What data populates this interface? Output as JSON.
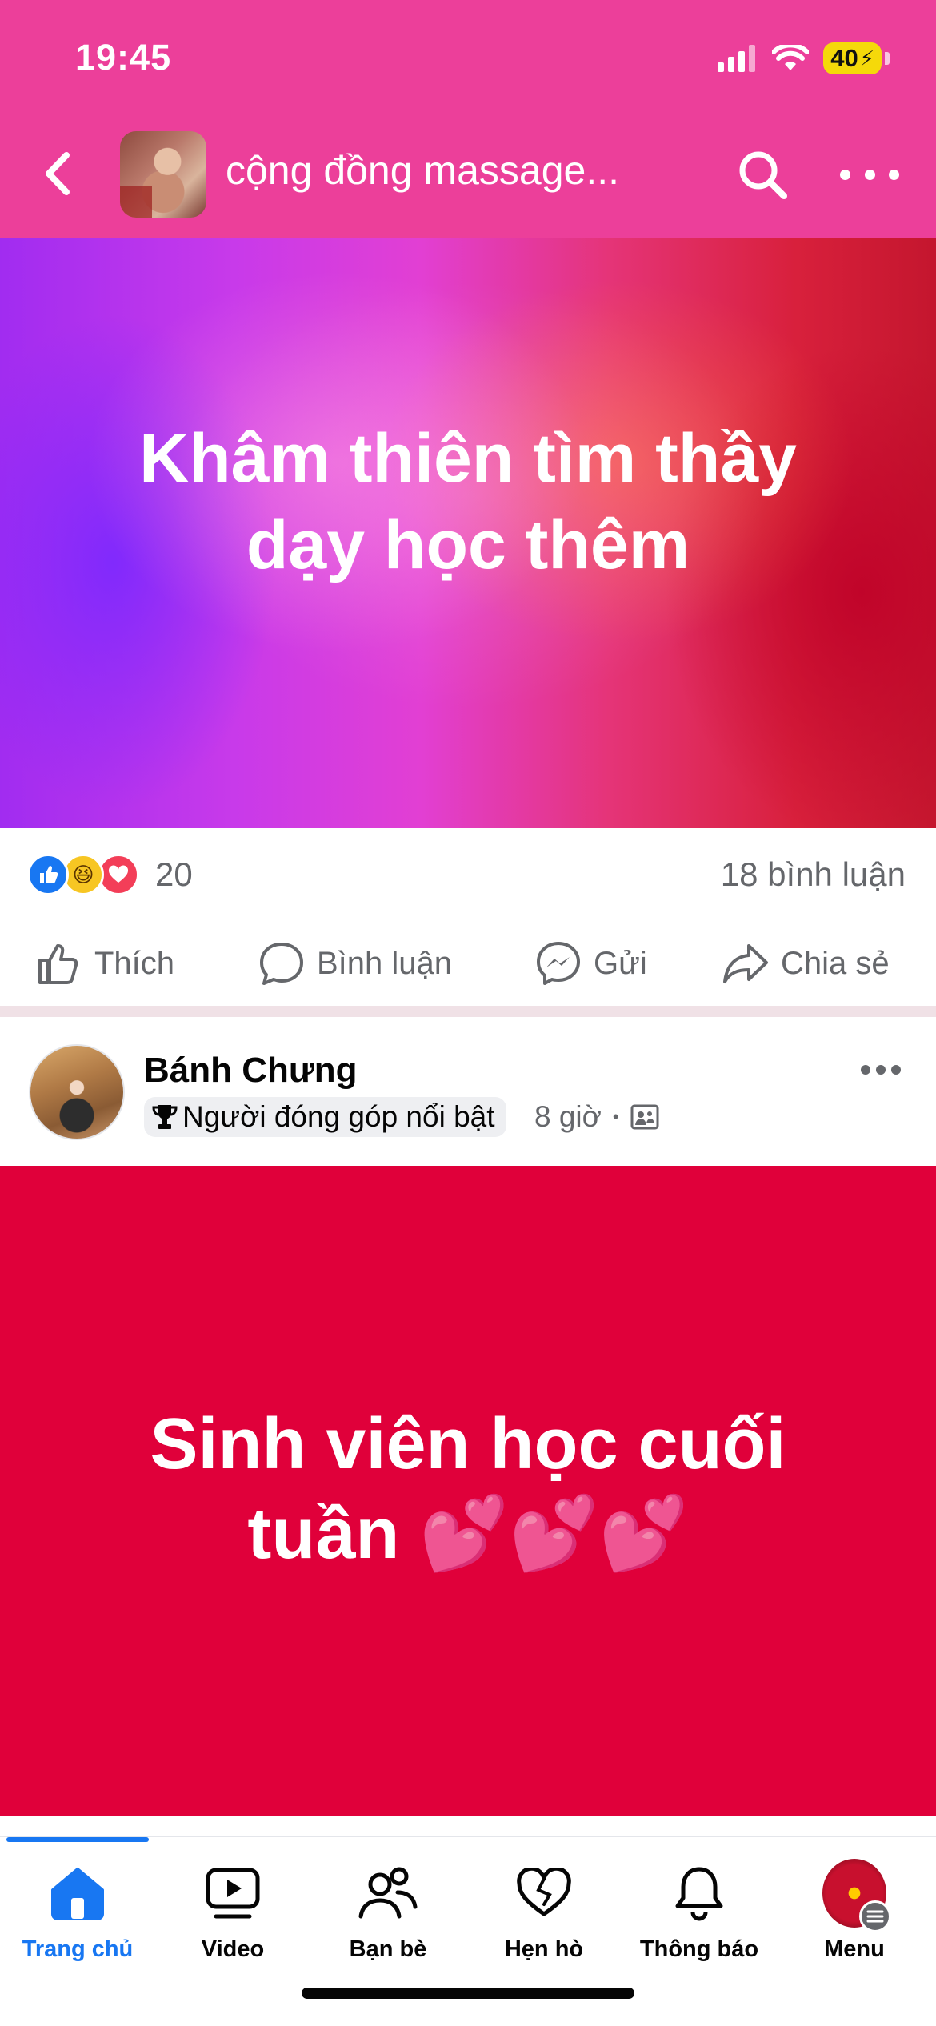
{
  "status_bar": {
    "time": "19:45",
    "battery": "40"
  },
  "header": {
    "group_title": "cộng đồng massage..."
  },
  "post1": {
    "text_line1": "Khâm thiên tìm thầy",
    "text_line2": "dạy học thêm",
    "reaction_count": "20",
    "comment_count": "18 bình luận",
    "actions": {
      "like": "Thích",
      "comment": "Bình luận",
      "send": "Gửi",
      "share": "Chia sẻ"
    },
    "colors": {
      "gradient_left": "#a12cf0",
      "gradient_right": "#c4162e"
    }
  },
  "post2": {
    "author": "Bánh Chưng",
    "badge": "Người đóng góp nổi bật",
    "time": "8 giờ",
    "text_line1": "Sinh viên học cuối",
    "text_line2": "tuần 💕💕💕",
    "background": "#e0003a"
  },
  "tabbar": {
    "tabs": [
      {
        "label": "Trang chủ",
        "icon": "home-icon",
        "active": true
      },
      {
        "label": "Video",
        "icon": "video-icon"
      },
      {
        "label": "Bạn bè",
        "icon": "friends-icon"
      },
      {
        "label": "Hẹn hò",
        "icon": "dating-heart-icon"
      },
      {
        "label": "Thông báo",
        "icon": "bell-icon"
      },
      {
        "label": "Menu",
        "icon": "menu-avatar-icon"
      }
    ]
  },
  "accent_color": "#1877f2",
  "header_color": "#ec3f9a"
}
